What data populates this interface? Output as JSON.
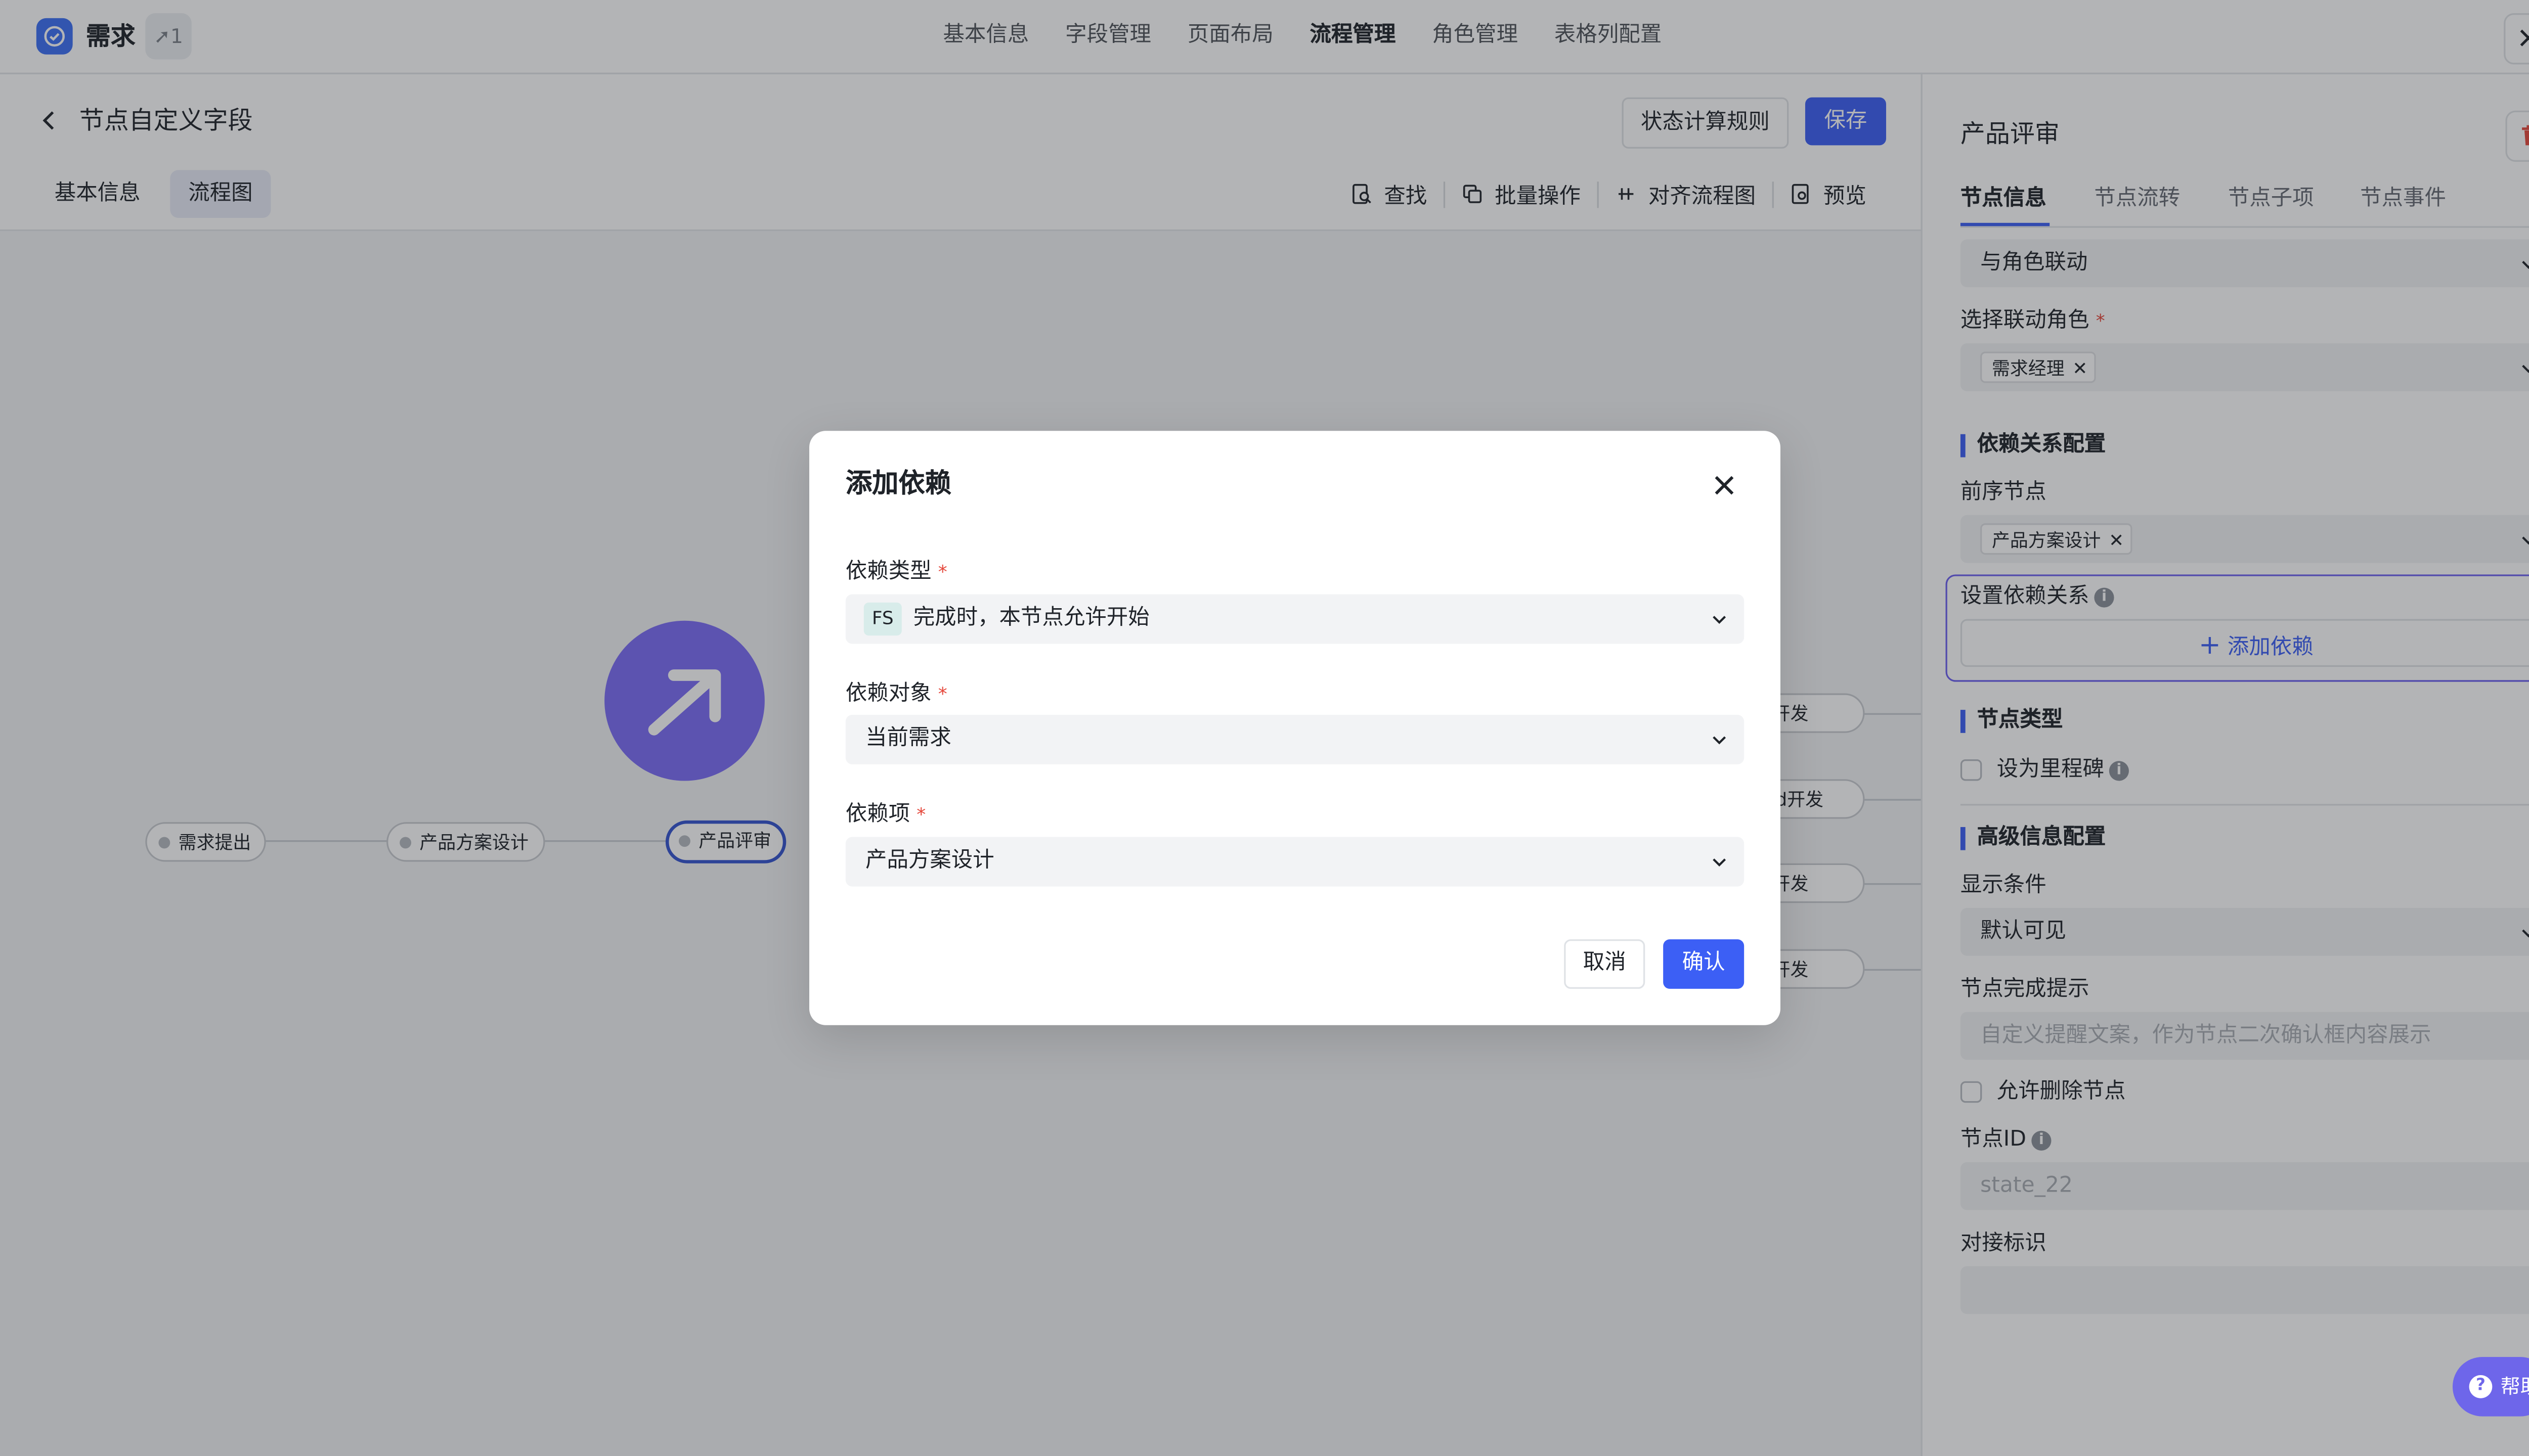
{
  "app": {
    "title": "需求",
    "share_count": "1"
  },
  "top_tabs": [
    "基本信息",
    "字段管理",
    "页面布局",
    "流程管理",
    "角色管理",
    "表格列配置"
  ],
  "top_tabs_active_index": 3,
  "page": {
    "title": "节点自定义字段",
    "rule_button": "状态计算规则",
    "save_button": "保存",
    "subtabs": [
      "基本信息",
      "流程图"
    ],
    "toolbar": {
      "find": "查找",
      "batch": "批量操作",
      "align": "对齐流程图",
      "preview": "预览"
    }
  },
  "flow": {
    "nodes": [
      "需求提出",
      "产品方案设计",
      "产品评审"
    ],
    "right_nodes": [
      "开发",
      "roid开发",
      "开发",
      "n开发"
    ]
  },
  "right_panel": {
    "title": "产品评审",
    "tabs": [
      "节点信息",
      "节点流转",
      "节点子项",
      "节点事件"
    ],
    "role_link_select": "与角色联动",
    "role_label": "选择联动角色",
    "role_tag": "需求经理",
    "dep_section": "依赖关系配置",
    "prev_node_label": "前序节点",
    "prev_node_tag": "产品方案设计",
    "set_dep_label": "设置依赖关系",
    "add_dep_button": "添加依赖",
    "node_type_section": "节点类型",
    "milestone_label": "设为里程碑",
    "advanced_section": "高级信息配置",
    "display_cond_label": "显示条件",
    "display_cond_value": "默认可见",
    "completion_label": "节点完成提示",
    "completion_placeholder": "自定义提醒文案，作为节点二次确认框内容展示",
    "allow_delete_label": "允许删除节点",
    "node_id_label": "节点ID",
    "node_id_placeholder": "state_22",
    "docking_label": "对接标识",
    "help_button": "帮助"
  },
  "modal": {
    "title": "添加依赖",
    "dep_type_label": "依赖类型",
    "dep_type_badge": "FS",
    "dep_type_value": "完成时，本节点允许开始",
    "dep_object_label": "依赖对象",
    "dep_object_value": "当前需求",
    "dep_item_label": "依赖项",
    "dep_item_value": "产品方案设计",
    "cancel": "取消",
    "confirm": "确认",
    "required_mark": "*"
  },
  "icons": {
    "app_logo": "check-circle-icon",
    "close": "close-icon",
    "back": "chevron-left-icon",
    "find": "search-doc-icon",
    "batch": "copy-icon",
    "align": "align-icon",
    "preview": "preview-icon",
    "delete": "trash-icon",
    "info": "info-icon",
    "help": "question-icon",
    "add": "plus-icon",
    "dropdown": "chevron-down-icon",
    "node_circle": "arrow-up-right-icon"
  },
  "colors": {
    "accent": "#3c5ff5",
    "selected_node_border": "#3554d1",
    "circle_node": "#7b6cf6",
    "required": "#e5483c",
    "help_button": "#6e66ea"
  }
}
